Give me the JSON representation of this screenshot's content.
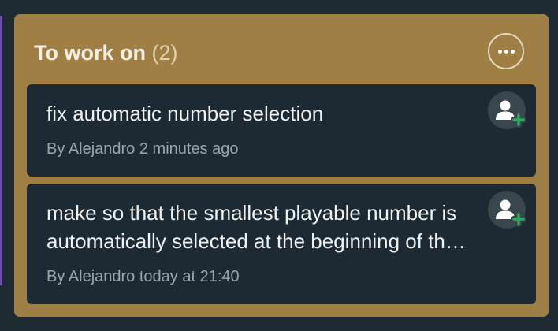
{
  "board": {
    "accent_color": "#6b4fa8",
    "column": {
      "title": "To work on",
      "count": "(2)",
      "background_color": "#a07f44",
      "menu_icon": "more-horizontal-icon",
      "cards": [
        {
          "title": "fix automatic number selection",
          "meta": "By Alejandro 2 minutes ago",
          "assign_icon": "add-assignee-icon"
        },
        {
          "title": "make so that the smallest playable number is automatically selected at the beginning of the turn",
          "meta": "By Alejandro today at 21:40",
          "assign_icon": "add-assignee-icon"
        }
      ]
    }
  }
}
